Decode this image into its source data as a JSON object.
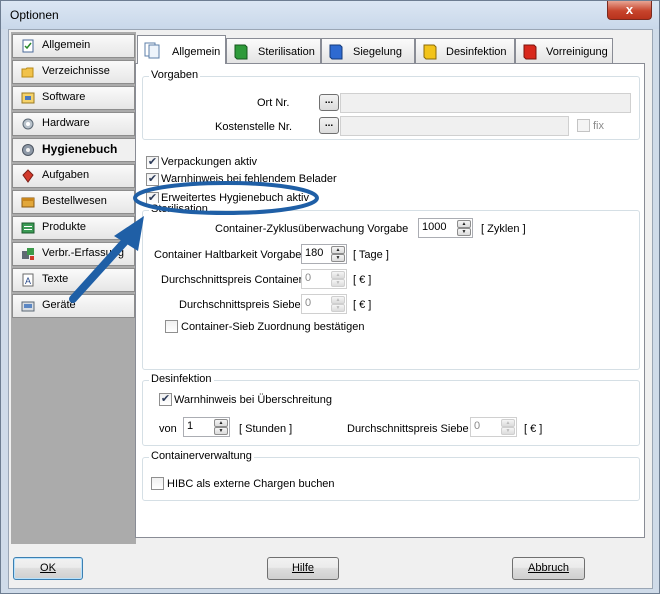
{
  "window": {
    "title": "Optionen",
    "close_glyph": "x"
  },
  "nav": [
    {
      "label": "Allgemein",
      "icon": "checklist-icon"
    },
    {
      "label": "Verzeichnisse",
      "icon": "folder-icon"
    },
    {
      "label": "Software",
      "icon": "software-icon"
    },
    {
      "label": "Hardware",
      "icon": "hardware-icon"
    },
    {
      "label": "Hygienebuch",
      "icon": "gear-icon",
      "active": true
    },
    {
      "label": "Aufgaben",
      "icon": "tasks-icon"
    },
    {
      "label": "Bestellwesen",
      "icon": "order-icon"
    },
    {
      "label": "Produkte",
      "icon": "products-icon"
    },
    {
      "label": "Verbr.-Erfassung",
      "icon": "consumption-icon"
    },
    {
      "label": "Texte",
      "icon": "text-icon"
    },
    {
      "label": "Geräte",
      "icon": "devices-icon"
    }
  ],
  "tabs": [
    {
      "label": "Allgemein",
      "icon": "pages-icon",
      "active": true
    },
    {
      "label": "Sterilisation",
      "icon": "green-book-icon"
    },
    {
      "label": "Siegelung",
      "icon": "blue-book-icon"
    },
    {
      "label": "Desinfektion",
      "icon": "yellow-book-icon"
    },
    {
      "label": "Vorreinigung",
      "icon": "red-book-icon"
    }
  ],
  "vorgaben": {
    "title": "Vorgaben",
    "ort_label": "Ort Nr.",
    "ort_value": "",
    "kostenstelle_label": "Kostenstelle Nr.",
    "kostenstelle_value": "",
    "fix_label": "fix",
    "fix_checked": false,
    "browse_glyph": "..."
  },
  "options": {
    "verpackungen_label": "Verpackungen aktiv",
    "verpackungen_checked": true,
    "warnhinweis_label": "Warnhinweis bei fehlendem Belader",
    "warnhinweis_checked": true,
    "erweitert_label": "Erweitertes Hygienebuch aktiv",
    "erweitert_checked": true
  },
  "sterilisation": {
    "title": "Sterilisation",
    "zyklus_label": "Container-Zyklusüberwachung Vorgabe",
    "zyklus_value": "1000",
    "zyklus_unit": "[ Zyklen ]",
    "haltbarkeit_label": "Container Haltbarkeit Vorgabe",
    "haltbarkeit_value": "180",
    "haltbarkeit_unit": "[ Tage ]",
    "preis_container_label": "Durchschnittspreis Container",
    "preis_container_value": "0",
    "preis_container_unit": "[ € ]",
    "preis_siebe_label": "Durchschnittspreis Siebe",
    "preis_siebe_value": "0",
    "preis_siebe_unit": "[ € ]",
    "zuordnung_label": "Container-Sieb Zuordnung bestätigen",
    "zuordnung_checked": false
  },
  "desinfektion": {
    "title": "Desinfektion",
    "warn_label": "Warnhinweis bei Überschreitung",
    "warn_checked": true,
    "von_label": "von",
    "von_value": "1",
    "von_unit": "[ Stunden ]",
    "preis_siebe_label": "Durchschnittspreis Siebe",
    "preis_siebe_value": "0",
    "preis_siebe_unit": "[ € ]"
  },
  "containerverwaltung": {
    "title": "Containerverwaltung",
    "hibc_label": "HIBC als externe Chargen buchen",
    "hibc_checked": false
  },
  "buttons": {
    "ok": "OK",
    "hilfe": "Hilfe",
    "abbruch": "Abbruch"
  },
  "annotation": {
    "color": "#1f5fa6"
  },
  "colors": {
    "accent": "#3c7fb1",
    "window_frame": "#cfdbe9"
  }
}
